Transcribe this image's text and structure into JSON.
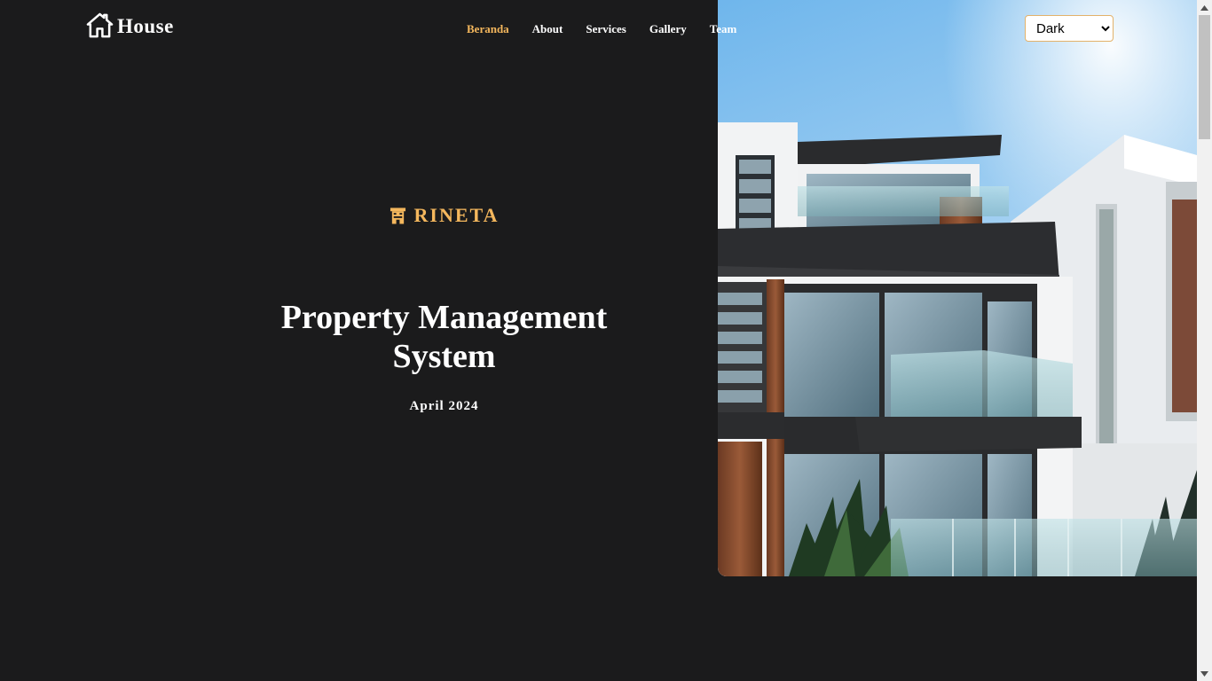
{
  "header": {
    "brand": "House",
    "nav": [
      {
        "label": "Beranda",
        "active": true
      },
      {
        "label": "About",
        "active": false
      },
      {
        "label": "Services",
        "active": false
      },
      {
        "label": "Gallery",
        "active": false
      },
      {
        "label": "Team",
        "active": false
      }
    ],
    "theme_select": {
      "value": "Dark",
      "options": [
        "Dark"
      ]
    }
  },
  "hero": {
    "tagline": "RINETA",
    "title": "Property Management System",
    "date": "April 2024",
    "image_icon": "modern-house-photo"
  },
  "icons": {
    "brand": "house-icon",
    "tagline": "building-icon"
  },
  "colors": {
    "background": "#1b1b1c",
    "accent": "#f4b75d",
    "text": "#ffffff"
  }
}
